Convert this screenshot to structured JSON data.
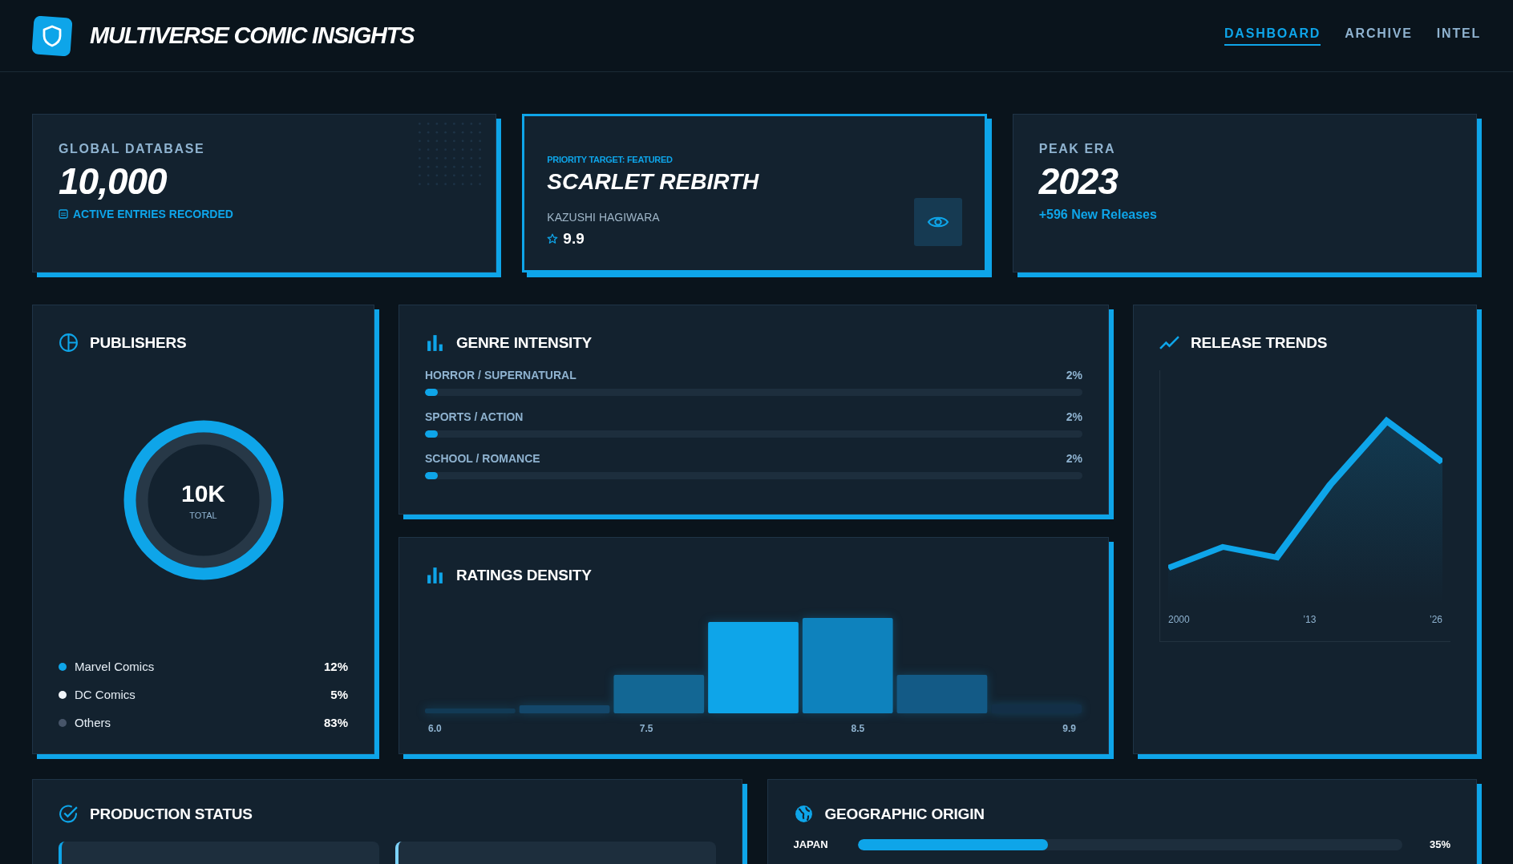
{
  "header": {
    "title": "MULTIVERSE COMIC INSIGHTS",
    "nav": [
      {
        "label": "DASHBOARD",
        "selected": true
      },
      {
        "label": "ARCHIVE",
        "selected": false
      },
      {
        "label": "INTEL",
        "selected": false
      }
    ]
  },
  "stats": [
    {
      "kind": "stat",
      "label": "GLOBAL DATABASE",
      "value": "10,000",
      "note": "ACTIVE ENTRIES RECORDED",
      "note_icon": true
    },
    {
      "kind": "featured",
      "eyebrow": "PRIORITY TARGET: FEATURED",
      "title": "SCARLET REBIRTH",
      "author": "KAZUSHI HAGIWARA",
      "rating": "9.9"
    },
    {
      "kind": "stat",
      "label": "PEAK ERA",
      "value": "2023",
      "note": "+596 New Releases",
      "note_icon": false
    }
  ],
  "publishers": {
    "title": "PUBLISHERS",
    "center_value": "10K",
    "center_label": "TOTAL",
    "legend": [
      {
        "name": "Marvel Comics",
        "value": "12%",
        "color": "#0ea5e9"
      },
      {
        "name": "DC Comics",
        "value": "5%",
        "color": "#f1f5f9"
      },
      {
        "name": "Others",
        "value": "83%",
        "color": "#475569"
      }
    ]
  },
  "genres": {
    "title": "GENRE INTENSITY",
    "items": [
      {
        "name": "HORROR / SUPERNATURAL",
        "value": "2%",
        "level": 0.02
      },
      {
        "name": "SPORTS / ACTION",
        "value": "2%",
        "level": 0.02
      },
      {
        "name": "SCHOOL / ROMANCE",
        "value": "2%",
        "level": 0.02
      }
    ]
  },
  "ratings": {
    "title": "RATINGS DENSITY",
    "axis_labels": [
      "6.0",
      "7.5",
      "8.5",
      "9.9"
    ]
  },
  "trends": {
    "title": "RELEASE TRENDS",
    "axis_labels": [
      "2000",
      "’13",
      "’26"
    ]
  },
  "production": {
    "title": "PRODUCTION STATUS",
    "status_cards": [
      {
        "color": "#0ea5e9"
      },
      {
        "color": "#7dd3fc"
      }
    ]
  },
  "origin": {
    "title": "GEOGRAPHIC ORIGIN",
    "items": [
      {
        "name": "JAPAN",
        "value": "35%",
        "level": 0.35
      }
    ]
  }
}
